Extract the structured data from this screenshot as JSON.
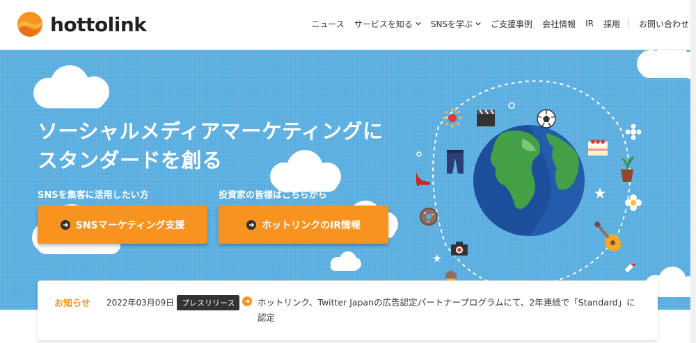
{
  "brand": {
    "name": "hottolink"
  },
  "nav": {
    "items": [
      {
        "label": "ニュース",
        "has_dropdown": false
      },
      {
        "label": "サービスを知る",
        "has_dropdown": true
      },
      {
        "label": "SNSを学ぶ",
        "has_dropdown": true
      },
      {
        "label": "ご支援事例",
        "has_dropdown": false
      },
      {
        "label": "会社情報",
        "has_dropdown": false
      },
      {
        "label": "IR",
        "has_dropdown": false
      },
      {
        "label": "採用",
        "has_dropdown": false
      }
    ],
    "contact_label": "お問い合わせ"
  },
  "hero": {
    "headline_line1": "ソーシャルメディアマーケティングに",
    "headline_line2": "スタンダードを創る",
    "cta_sns_caption": "SNSを集客に活用したい方",
    "cta_sns_label": "SNSマーケティング支援",
    "cta_ir_caption": "投資家の皆様はこちらから",
    "cta_ir_label": "ホットリンクのIR情報"
  },
  "news": {
    "heading": "お知らせ",
    "date": "2022年03月09日",
    "category": "プレスリリース",
    "text": "ホットリンク、Twitter Japanの広告認定パートナープログラムにて、2年連続で「Standard」に認定"
  },
  "colors": {
    "accent": "#f7931e",
    "sky": "#5aaee0",
    "dark": "#333333"
  },
  "icons": [
    "logo-icon",
    "chevron-down-icon",
    "arrow-right-circle-icon",
    "earth-icon",
    "sun-icon",
    "clapperboard-icon",
    "soccer-ball-icon",
    "cake-icon",
    "flower-icon",
    "jeans-icon",
    "high-heel-icon",
    "plant-icon",
    "star-icon",
    "donut-icon",
    "camera-icon",
    "guitar-icon",
    "ice-cream-icon",
    "coffee-icon",
    "heart-message-icon",
    "picture-icon",
    "sneaker-icon",
    "lipstick-icon",
    "omelette-icon",
    "snowflake-icon"
  ]
}
